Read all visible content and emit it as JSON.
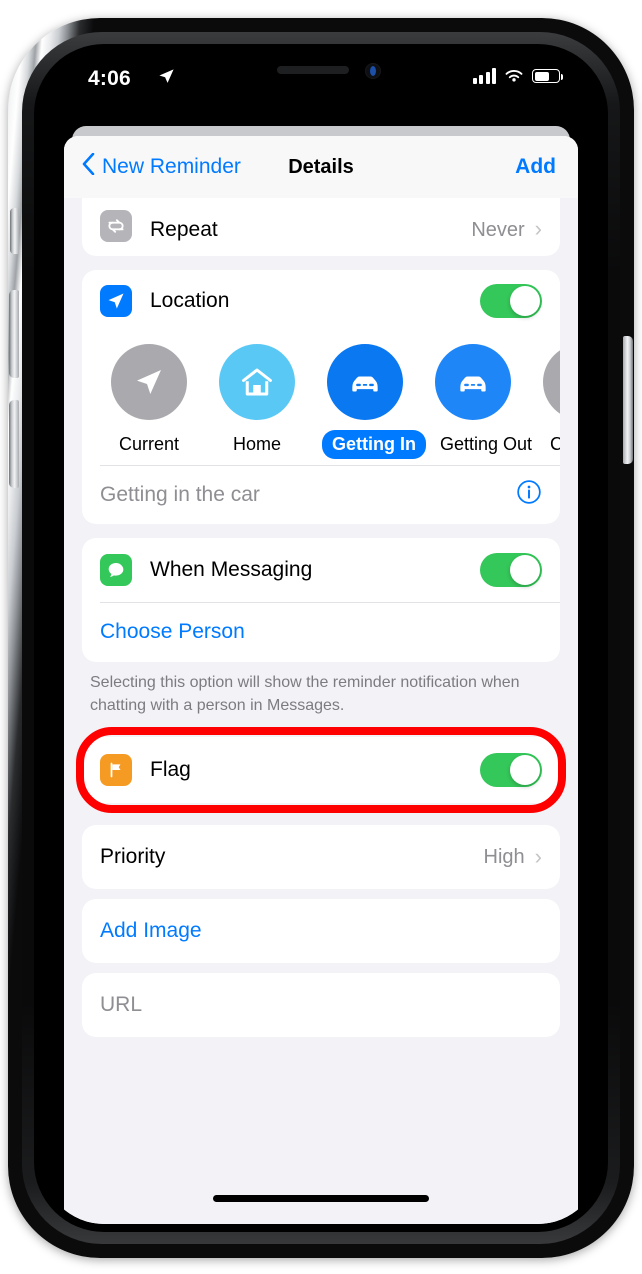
{
  "status_bar": {
    "time": "4:06",
    "location_arrow_icon": "location-arrow-icon",
    "signal_icon": "cellular-signal-icon",
    "signal_bars": 4,
    "wifi_icon": "wifi-icon",
    "battery_icon": "battery-icon",
    "battery_percent": 65
  },
  "nav": {
    "back_label": "New Reminder",
    "back_chevron_icon": "chevron-left-icon",
    "title": "Details",
    "add_label": "Add"
  },
  "repeat": {
    "icon": "repeat-icon",
    "label": "Repeat",
    "value": "Never",
    "chevron_icon": "chevron-right-icon",
    "icon_color": "#b4b4b9"
  },
  "location": {
    "icon": "location-arrow-icon",
    "label": "Location",
    "icon_color": "#007aff",
    "toggle_on": true,
    "toggle_color": "#34c759",
    "chips": [
      {
        "label": "Current",
        "icon": "navigation-arrow-icon",
        "color": "#a9a9ae",
        "selected": false
      },
      {
        "label": "Home",
        "icon": "house-icon",
        "color": "#5ac8f5",
        "selected": false
      },
      {
        "label": "Getting In",
        "icon": "car-icon",
        "color": "#0a78f0",
        "selected": true
      },
      {
        "label": "Getting Out",
        "icon": "car-icon",
        "color": "#1f86f7",
        "selected": false
      },
      {
        "label": "Custom",
        "icon": "ellipsis-icon",
        "color": "#a9a9ae",
        "selected": false
      }
    ],
    "field_text": "Getting in the car",
    "info_icon": "info-circle-icon"
  },
  "messaging": {
    "icon": "messages-bubble-icon",
    "label": "When Messaging",
    "icon_color": "#34c759",
    "toggle_on": true,
    "choose_person_label": "Choose Person",
    "footnote": "Selecting this option will show the reminder notification when chatting with a person in Messages."
  },
  "flag": {
    "icon": "flag-icon",
    "label": "Flag",
    "icon_color": "#f59a23",
    "toggle_on": true,
    "highlight_color": "#ff0000"
  },
  "priority": {
    "label": "Priority",
    "value": "High",
    "chevron_icon": "chevron-right-icon"
  },
  "add_image": {
    "label": "Add Image"
  },
  "url": {
    "placeholder": "URL"
  }
}
